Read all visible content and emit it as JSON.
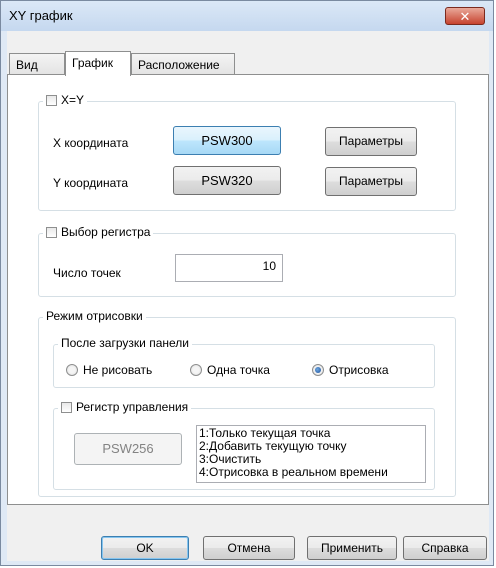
{
  "window": {
    "title": "XY график",
    "close_icon": "✕"
  },
  "tabs": [
    {
      "label": "Вид",
      "active": false
    },
    {
      "label": "График",
      "active": true
    },
    {
      "label": "Расположение",
      "active": false
    }
  ],
  "xy_group": {
    "checkbox_label": "X=Y",
    "x_label": "X координата",
    "x_button": "PSW300",
    "x_params": "Параметры",
    "y_label": "Y координата",
    "y_button": "PSW320",
    "y_params": "Параметры"
  },
  "register_group": {
    "checkbox_label": "Выбор регистра",
    "points_label": "Число точек",
    "points_value": "10"
  },
  "draw_mode": {
    "caption": "Режим отрисовки",
    "after_load": {
      "caption": "После загрузки панели",
      "options": [
        "Не рисовать",
        "Одна точка",
        "Отрисовка"
      ],
      "selected": "Отрисовка"
    },
    "control_register": {
      "checkbox_label": "Регистр управления",
      "button": "PSW256",
      "list": [
        "1:Только текущая точка",
        "2:Добавить текущую точку",
        "3:Очистить",
        "4:Отрисовка в реальном времени"
      ]
    }
  },
  "footer": {
    "ok": "OK",
    "cancel": "Отмена",
    "apply": "Применить",
    "help": "Справка"
  }
}
